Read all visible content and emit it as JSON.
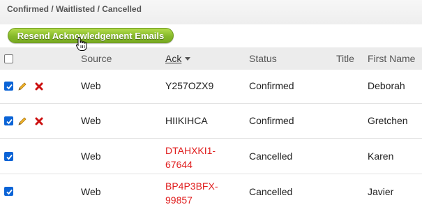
{
  "breadcrumb": "Confirmed / Waitlisted / Cancelled",
  "resend_button_label": "Resend Acknowledgement Emails",
  "columns": {
    "source": "Source",
    "ack": "Ack",
    "status": "Status",
    "title": "Title",
    "first_name": "First Name"
  },
  "rows": [
    {
      "checked": true,
      "source": "Web",
      "ack_line1": "Y257OZX9",
      "ack_line2": "",
      "ack_red": false,
      "status": "Confirmed",
      "title": "",
      "first_name": "Deborah",
      "actions": [
        "edit-pencil-icon",
        "delete-x-icon"
      ]
    },
    {
      "checked": true,
      "source": "Web",
      "ack_line1": "HIIKIHCA",
      "ack_line2": "",
      "ack_red": false,
      "status": "Confirmed",
      "title": "",
      "first_name": "Gretchen",
      "actions": [
        "edit-pencil-icon",
        "delete-x-icon"
      ]
    },
    {
      "checked": true,
      "source": "Web",
      "ack_line1": "DTAHXKI1-",
      "ack_line2": "67644",
      "ack_red": true,
      "status": "Cancelled",
      "title": "",
      "first_name": "Karen",
      "actions": []
    },
    {
      "checked": true,
      "source": "Web",
      "ack_line1": "BP4P3BFX-",
      "ack_line2": "99857",
      "ack_red": true,
      "status": "Cancelled",
      "title": "",
      "first_name": "Javier",
      "actions": []
    }
  ],
  "colors": {
    "button_green": "#86b92a",
    "cancelled_red": "#e02020",
    "checkbox_blue": "#0a63d6",
    "delete_red": "#cc1111"
  }
}
